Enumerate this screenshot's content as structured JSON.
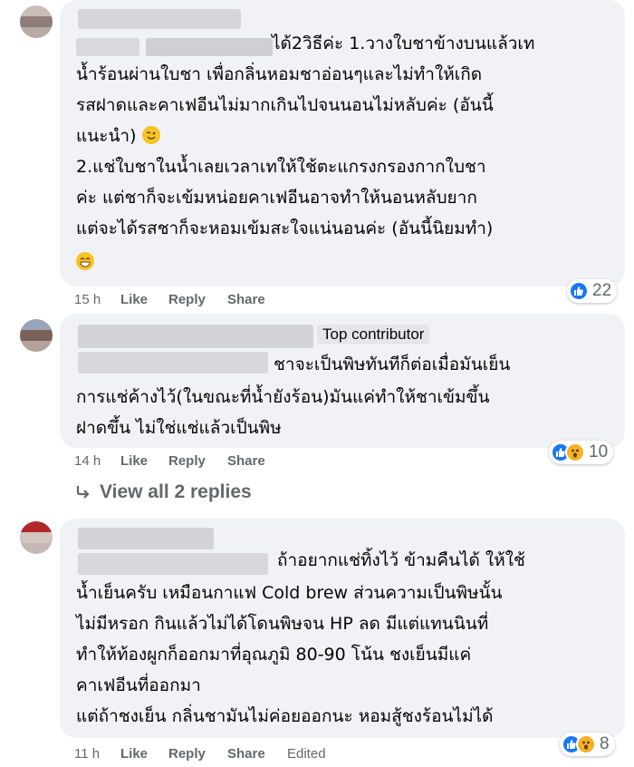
{
  "comments": [
    {
      "lines": [
        "ได้2วิธีค่ะ 1.วางใบชาข้างบนแล้วเท",
        "น้ำร้อนผ่านใบชา เพื่อกลิ่นหอมชาอ่อนๆและไม่ทำให้เกิด",
        "รสฝาดและคาเฟอีนไม่มากเกินไปจนนอนไม่หลับค่ะ (อันนี้",
        "แนะนำ)",
        "2.แช่ใบชาในน้ำเลยเวลาเทให้ใช้ตะแกรงกรองกากใบชา",
        "ค่ะ แต่ชาก็จะเข้มหน่อยคาเฟอีนอาจทำให้นอนหลับยาก",
        "แต่จะได้รสชาก็จะหอมเข้มสะใจแน่นอนค่ะ (อันนี้นิยมทำ)"
      ],
      "time": "15 h",
      "like": "Like",
      "reply": "Reply",
      "share": "Share",
      "reaction_count": "22"
    },
    {
      "badge": "Top contributor",
      "lines": [
        "ชาจะเป็นพิษทันทีก็ต่อเมื่อมันเย็น",
        "การแช่ค้างไว้(ในขณะที่น้ำยังร้อน)มันแค่ทำให้ชาเข้มขึ้น",
        "ฝาดขึ้น ไม่ใช่แช่แล้วเป็นพิษ"
      ],
      "time": "14 h",
      "like": "Like",
      "reply": "Reply",
      "share": "Share",
      "reaction_count": "10"
    },
    {
      "lines": [
        "ถ้าอยากแช่ทิ้งไว้ ข้ามคืนได้ ให้ใช้",
        "น้ำเย็นครับ เหมือนกาแฟ Cold brew ส่วนความเป็นพิษนั้น",
        "ไม่มีหรอก กินแล้วไม่ได้โดนพิษจน HP ลด มีแต่แทนนินที่",
        "ทำให้ท้องผูกก็ออกมาที่อุณภูมิ 80-90 โน้น ชงเย็นมีแค่",
        "คาเฟอีนที่ออกมา",
        "แต่ถ้าชงเย็น กลิ่นชามันไม่ค่อยออกนะ หอมสู้ชงร้อนไม่ได้"
      ],
      "time": "11 h",
      "like": "Like",
      "reply": "Reply",
      "share": "Share",
      "edited": "Edited",
      "reaction_count": "8"
    }
  ],
  "view_replies": "View all 2 replies",
  "colors": {
    "like_blue": "#1877f2",
    "wow_yellow": "#f7b125",
    "bubble": "#f0f2f5",
    "meta": "#65676b"
  }
}
